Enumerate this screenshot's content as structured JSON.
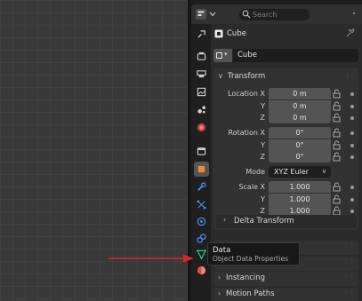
{
  "header": {
    "search_placeholder": "Search",
    "editor_type_icon": "properties-editor-icon"
  },
  "tabs": [
    {
      "name": "tool-tab",
      "icon": "tool-icon",
      "color": "#cfcfcf"
    },
    {
      "name": "render-tab",
      "icon": "render-icon",
      "color": "#cfcfcf"
    },
    {
      "name": "output-tab",
      "icon": "output-icon",
      "color": "#cfcfcf"
    },
    {
      "name": "view-layer-tab",
      "icon": "view-layer-icon",
      "color": "#cfcfcf"
    },
    {
      "name": "scene-tab",
      "icon": "scene-icon",
      "color": "#cfcfcf"
    },
    {
      "name": "world-tab",
      "icon": "world-icon",
      "color": "#c43f3f"
    },
    {
      "name": "collection-tab",
      "icon": "collection-icon",
      "color": "#cfcfcf"
    },
    {
      "name": "object-tab",
      "icon": "object-icon",
      "color": "#f08a2b",
      "active": true
    },
    {
      "name": "modifier-tab",
      "icon": "wrench-icon",
      "color": "#4a8ee8"
    },
    {
      "name": "particles-tab",
      "icon": "particles-icon",
      "color": "#4a8ee8"
    },
    {
      "name": "physics-tab",
      "icon": "physics-icon",
      "color": "#4a8ee8"
    },
    {
      "name": "constraints-tab",
      "icon": "constraints-icon",
      "color": "#4a8ee8"
    },
    {
      "name": "data-tab",
      "icon": "mesh-data-icon",
      "color": "#27c27e"
    },
    {
      "name": "material-tab",
      "icon": "material-icon",
      "color": "#e24b4b"
    }
  ],
  "context": {
    "object": "Cube"
  },
  "object_name": "Cube",
  "transform": {
    "title": "Transform",
    "location": {
      "label": "Location X",
      "y_label": "Y",
      "z_label": "Z",
      "x": "0 m",
      "y": "0 m",
      "z": "0 m"
    },
    "rotation": {
      "label": "Rotation X",
      "y_label": "Y",
      "z_label": "Z",
      "x": "0°",
      "y": "0°",
      "z": "0°"
    },
    "mode": {
      "label": "Mode",
      "value": "XYZ Euler"
    },
    "scale": {
      "label": "Scale X",
      "y_label": "Y",
      "z_label": "Z",
      "x": "1.000",
      "y": "1.000",
      "z": "1.000"
    },
    "delta": "Delta Transform"
  },
  "tooltip": {
    "title": "Data",
    "subtitle": "Object Data Properties"
  },
  "panels": {
    "instancing": "Instancing",
    "motion_paths": "Motion Paths"
  },
  "colors": {
    "annotation_arrow": "#d9262b",
    "accent_object": "#f08a2b",
    "accent_data": "#27c27e"
  }
}
